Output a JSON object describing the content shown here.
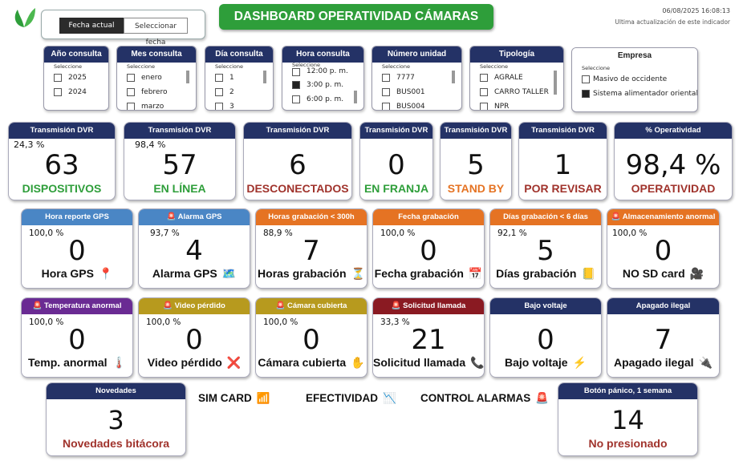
{
  "header": {
    "title": "DASHBOARD OPERATIVIDAD CÁMARAS",
    "timestamp": "06/08/2025 16:08:13",
    "timestamp_caption": "Ultima actualización de este indicador",
    "date_toggle": {
      "active": "Fecha actual",
      "inactive": "Seleccionar fecha"
    }
  },
  "slicers": {
    "anio": {
      "title": "Año consulta",
      "hint": "Seleccione",
      "items": [
        "2025",
        "2024"
      ]
    },
    "mes": {
      "title": "Mes consulta",
      "hint": "Seleccione",
      "items": [
        "enero",
        "febrero",
        "marzo"
      ]
    },
    "dia": {
      "title": "Día consulta",
      "hint": "Seleccione",
      "items": [
        "1",
        "2",
        "3"
      ]
    },
    "hora": {
      "title": "Hora consulta",
      "hint": "Seleccione",
      "items": [
        "12:00 p. m.",
        "3:00 p. m.",
        "6:00 p. m."
      ],
      "selected": "3:00 p. m."
    },
    "unidad": {
      "title": "Número unidad",
      "hint": "Seleccione",
      "items": [
        "7777",
        "BUS001",
        "BUS004"
      ]
    },
    "tipologia": {
      "title": "Tipología",
      "hint": "Seleccione",
      "items": [
        "AGRALE",
        "CARRO TALLER",
        "NPR"
      ]
    },
    "empresa": {
      "title": "Empresa",
      "hint": "Seleccione",
      "items": [
        "Masivo de occidente",
        "Sistema alimentador oriental"
      ],
      "selected": "Sistema alimentador oriental"
    }
  },
  "row1": [
    {
      "header": "Transmisión DVR",
      "pct": "24,3 %",
      "value": "63",
      "label": "DISPOSITIVOS",
      "color": "#2e9e3a"
    },
    {
      "header": "Transmisión DVR",
      "pct": "98,4 %",
      "value": "57",
      "label": "EN LÍNEA",
      "color": "#2e9e3a"
    },
    {
      "header": "Transmisión DVR",
      "pct": "",
      "value": "6",
      "label": "DESCONECTADOS",
      "color": "#a0332c"
    },
    {
      "header": "Transmisión DVR",
      "pct": "",
      "value": "0",
      "label": "EN FRANJA",
      "color": "#2e9e3a"
    },
    {
      "header": "Transmisión DVR",
      "pct": "",
      "value": "5",
      "label": "STAND BY",
      "color": "#e57323"
    },
    {
      "header": "Transmisión DVR",
      "pct": "",
      "value": "1",
      "label": "POR REVISAR",
      "color": "#a0332c"
    },
    {
      "header": "% Operatividad",
      "pct": "",
      "value": "98,4 %",
      "label": "OPERATIVIDAD",
      "color": "#a0332c"
    }
  ],
  "row2": [
    {
      "header": "Hora reporte GPS",
      "pct": "100,0 %",
      "value": "0",
      "label": "Hora GPS",
      "icon": "📍"
    },
    {
      "header": "🚨 Alarma GPS",
      "pct": "93,7 %",
      "value": "4",
      "label": "Alarma GPS",
      "icon": "🗺️"
    },
    {
      "header": "Horas grabación < 300h",
      "pct": "88,9 %",
      "value": "7",
      "label": "Horas grabación",
      "icon": "⏳"
    },
    {
      "header": "Fecha grabación",
      "pct": "100,0 %",
      "value": "0",
      "label": "Fecha grabación",
      "icon": "📅"
    },
    {
      "header": "Días grabación < 6 días",
      "pct": "92,1 %",
      "value": "5",
      "label": "Días grabación",
      "icon": "📒"
    },
    {
      "header": "🚨 Almacenamiento anormal",
      "pct": "100,0 %",
      "value": "0",
      "label": "NO SD card",
      "icon": "🎥"
    }
  ],
  "row3": [
    {
      "header": "🚨 Temperatura anormal",
      "pct": "100,0 %",
      "value": "0",
      "label": "Temp. anormal",
      "icon": "🌡️"
    },
    {
      "header": "🚨 Video pérdido",
      "pct": "100,0 %",
      "value": "0",
      "label": "Video pérdido",
      "icon": "❌"
    },
    {
      "header": "🚨 Cámara cubierta",
      "pct": "100,0 %",
      "value": "0",
      "label": "Cámara cubierta",
      "icon": "✋"
    },
    {
      "header": "🚨 Solicitud llamada",
      "pct": "33,3 %",
      "value": "21",
      "label": "Solicitud llamada",
      "icon": "📞"
    },
    {
      "header": "Bajo voltaje",
      "pct": "",
      "value": "0",
      "label": "Bajo voltaje",
      "icon": "⚡"
    },
    {
      "header": "Apagado ilegal",
      "pct": "",
      "value": "7",
      "label": "Apagado ilegal",
      "icon": "🔌"
    }
  ],
  "bottom": {
    "novedades": {
      "header": "Novedades",
      "value": "3",
      "label": "Novedades bitácora"
    },
    "sim_card": {
      "label": "SIM CARD",
      "icon": "📶"
    },
    "efectividad": {
      "label": "EFECTIVIDAD",
      "icon": "📉"
    },
    "control_alarmas": {
      "label": "CONTROL ALARMAS",
      "icon": "🚨"
    },
    "panico": {
      "header": "Botón pánico, 1 semana",
      "value": "14",
      "label": "No presionado"
    }
  }
}
